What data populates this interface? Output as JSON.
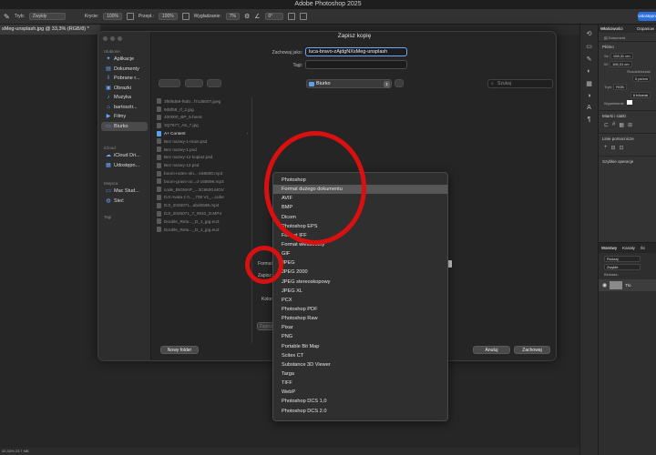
{
  "app": {
    "title": "Adobe Photoshop 2025",
    "share_label": "Udostępnij"
  },
  "options_bar": {
    "mode_label": "Tryb:",
    "mode_value": "Zwykły",
    "opacity_label": "Krycie:",
    "opacity_value": "100%",
    "flow_label": "Przepł.:",
    "flow_value": "100%",
    "smoothing_label": "Wygładzanie:",
    "smoothing_value": "7%",
    "angle_value": "0°"
  },
  "document": {
    "tab_title": "sMeg-unsplash.jpg @ 33,3% (RGB/8) *",
    "status": "40,33% 23,7 MB"
  },
  "right_panel": {
    "tabs": [
      "Właściwości",
      "Dopasow"
    ],
    "doc_label": "Dokument",
    "canvas_section": "Płótno",
    "w_label": "Sz:",
    "w_value": "108,31 cm",
    "h_label": "W:",
    "h_value": "108,31 cm",
    "resolution_label": "Rozdzielczość",
    "resolution_value": "0 px/cm",
    "mode_label": "Tryb:",
    "mode_value": "RGB",
    "bits_value": "8 b/kanał",
    "fill_label": "Wypełnienie",
    "rulers_section": "Miarki i siatki",
    "guides_section": "Linie pomocnicze",
    "quick_actions": "Szybkie operacje",
    "layers_tabs": [
      "Warstwy",
      "Kanały",
      "Śc"
    ],
    "search_placeholder": "Rodzaj",
    "blend_mode": "Zwykłe",
    "lock_label": "Blokada:",
    "layer_name": "Tło"
  },
  "dialog": {
    "title": "Zapisz kopię",
    "save_as_label": "Zachowaj jako:",
    "save_as_value": "luca-bravo-zAjdgNXsMeg-unsplash",
    "tags_label": "Tagi:",
    "location": "Biurko",
    "search_placeholder": "Szukaj",
    "format_label": "Format:",
    "save_label": "Zapisz:",
    "color_label": "Kolor:",
    "new_folder": "Nowy folder",
    "cancel": "Anuluj",
    "save": "Zachowaj",
    "hidden_button": "Zapisz"
  },
  "sidebar": {
    "favorites_label": "Ulubione",
    "favorites": [
      "Aplikacje",
      "Dokumenty",
      "Pobrane r...",
      "Obrazki",
      "Muzyka",
      "bartosztr...",
      "Filmy",
      "Biurko"
    ],
    "icloud_label": "iCloud",
    "icloud": [
      "iCloud Dri...",
      "Udostępn..."
    ],
    "places_label": "Miejsca",
    "places": [
      "Mac Stud...",
      "Sieć"
    ],
    "tags_label": "Tagi"
  },
  "files": [
    "3f6f9d69-f6d0...f7cd6007.jpeg",
    "9d8f58_rf_2.jpg",
    "400000_BP_5.heeic",
    "3Q7677_A6_7.jpg",
    "A+ Content",
    "Bez nazwy-1-main.psd",
    "Bez nazwy-1.psd",
    "Bez nazwy-12 kopia2.psd",
    "Bez nazwy-12.psd",
    "boom-notes-4m...-168600.mp3",
    "boom-grass-oo...d-168696.mp3",
    "code_BIGMAP_...3C8600.MOV",
    "DJI Avata 2 0..._708 V1_...cube",
    "DJI_2025071...abd0569.mp4",
    "DJI_2025071_7_0910_D.MP4",
    "Double_Retu..._D_1_jpg.eu3",
    "Double_Retu..._D_1_jpg.eu3"
  ],
  "format_menu": {
    "items": [
      "Photoshop",
      "Format dużego dokumentu",
      "AVIF",
      "BMP",
      "Dicom",
      "Photoshop EPS",
      "Format IFF",
      "Format wielokrotny",
      "GIF",
      "JPEG",
      "JPEG 2000",
      "JPEG stereoskopowy",
      "JPEG XL",
      "PCX",
      "Photoshop PDF",
      "Photoshop Raw",
      "Pixar",
      "PNG",
      "Portable Bit Map",
      "Scitex CT",
      "Substance 3D Viewer",
      "Targa",
      "TIFF",
      "WebP",
      "Photoshop DCS 1,0",
      "Photoshop DCS 2.0"
    ],
    "highlighted_index": 1
  },
  "colors": {
    "accent": "#2a6fdc",
    "annotation": "#d91010",
    "folder": "#5a9ff0"
  }
}
